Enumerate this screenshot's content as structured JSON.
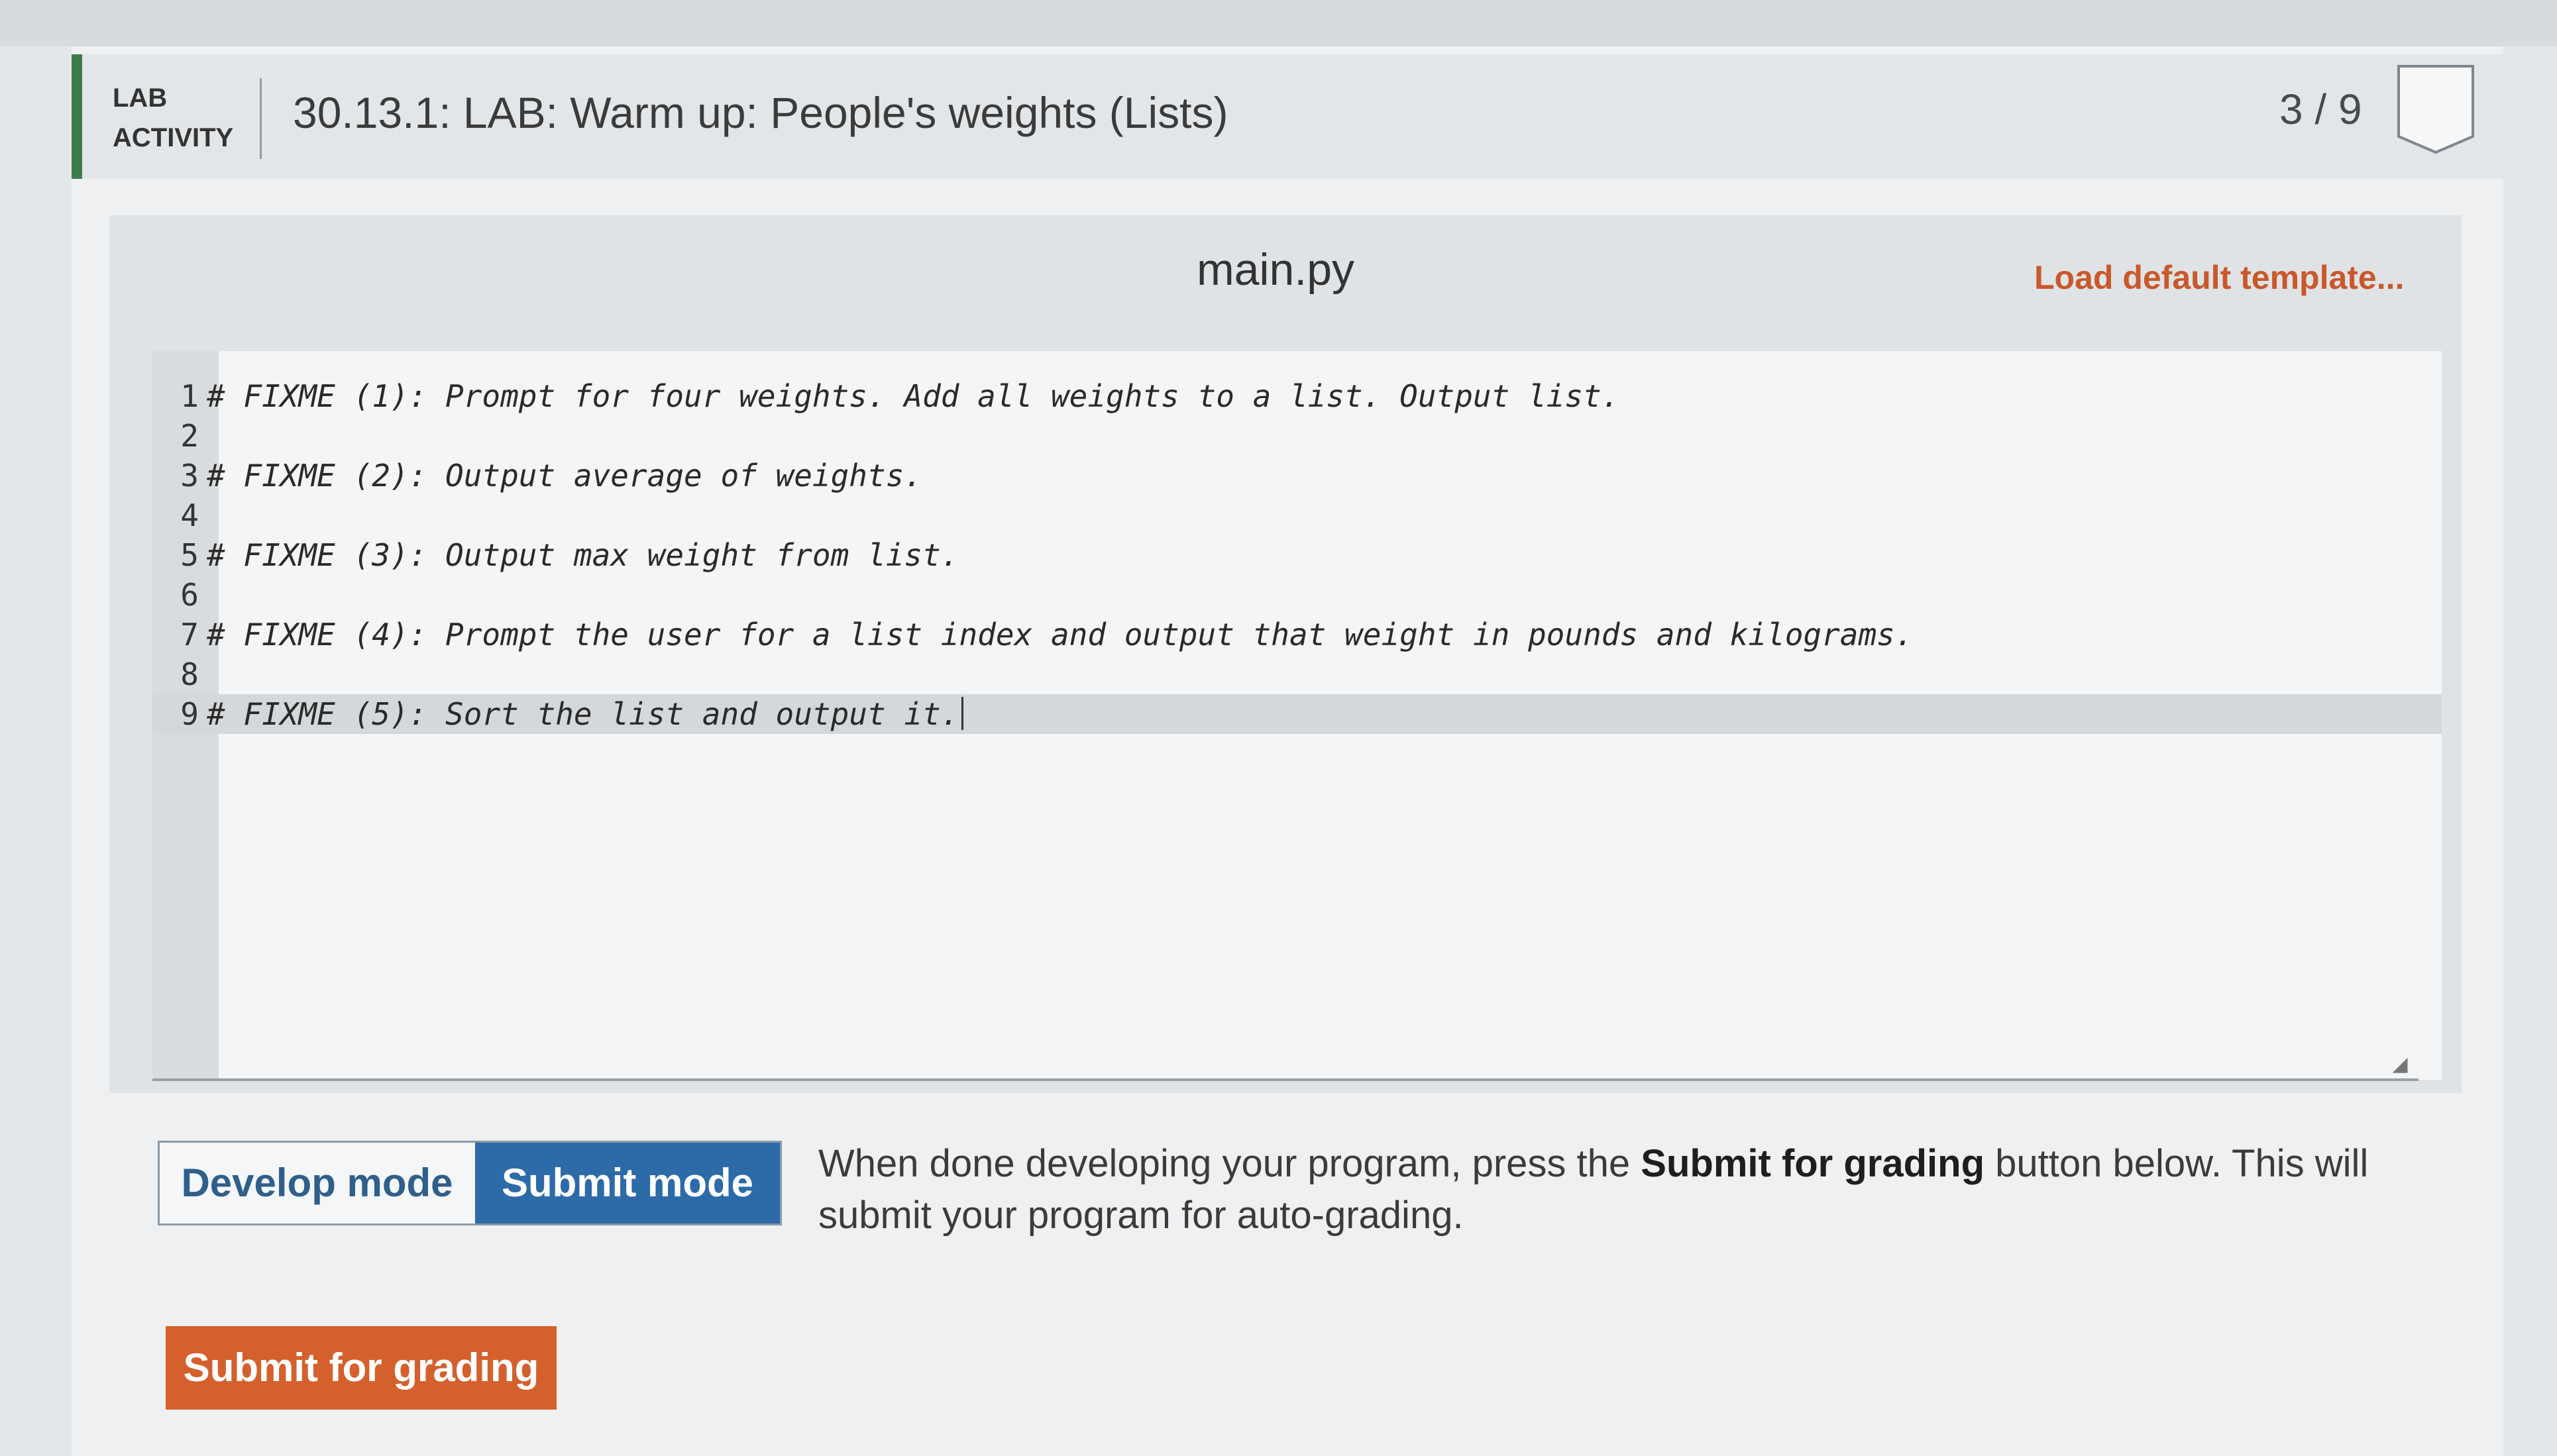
{
  "header": {
    "tag_line1": "LAB",
    "tag_line2": "ACTIVITY",
    "title": "30.13.1: LAB: Warm up: People's weights (Lists)",
    "progress": "3 / 9",
    "accent_color": "#3f7a4c"
  },
  "editor": {
    "file_name": "main.py",
    "load_template_label": "Load default template...",
    "active_line": 9,
    "lines": [
      {
        "num": "1",
        "text": "# FIXME (1): Prompt for four weights. Add all weights to a list. Output list."
      },
      {
        "num": "2",
        "text": ""
      },
      {
        "num": "3",
        "text": "# FIXME (2): Output average of weights."
      },
      {
        "num": "4",
        "text": ""
      },
      {
        "num": "5",
        "text": "# FIXME (3): Output max weight from list."
      },
      {
        "num": "6",
        "text": ""
      },
      {
        "num": "7",
        "text": "# FIXME (4): Prompt the user for a list index and output that weight in pounds and kilograms."
      },
      {
        "num": "8",
        "text": ""
      },
      {
        "num": "9",
        "text": "# FIXME (5): Sort the list and output it."
      }
    ]
  },
  "modes": {
    "develop_label": "Develop mode",
    "submit_label": "Submit mode",
    "selected": "Submit mode",
    "description_before": "When done developing your program, press the ",
    "description_bold": "Submit for grading",
    "description_after": " button below. This will submit your program for auto-grading."
  },
  "actions": {
    "submit_grading_label": "Submit for grading",
    "submit_color": "#d4612d"
  }
}
